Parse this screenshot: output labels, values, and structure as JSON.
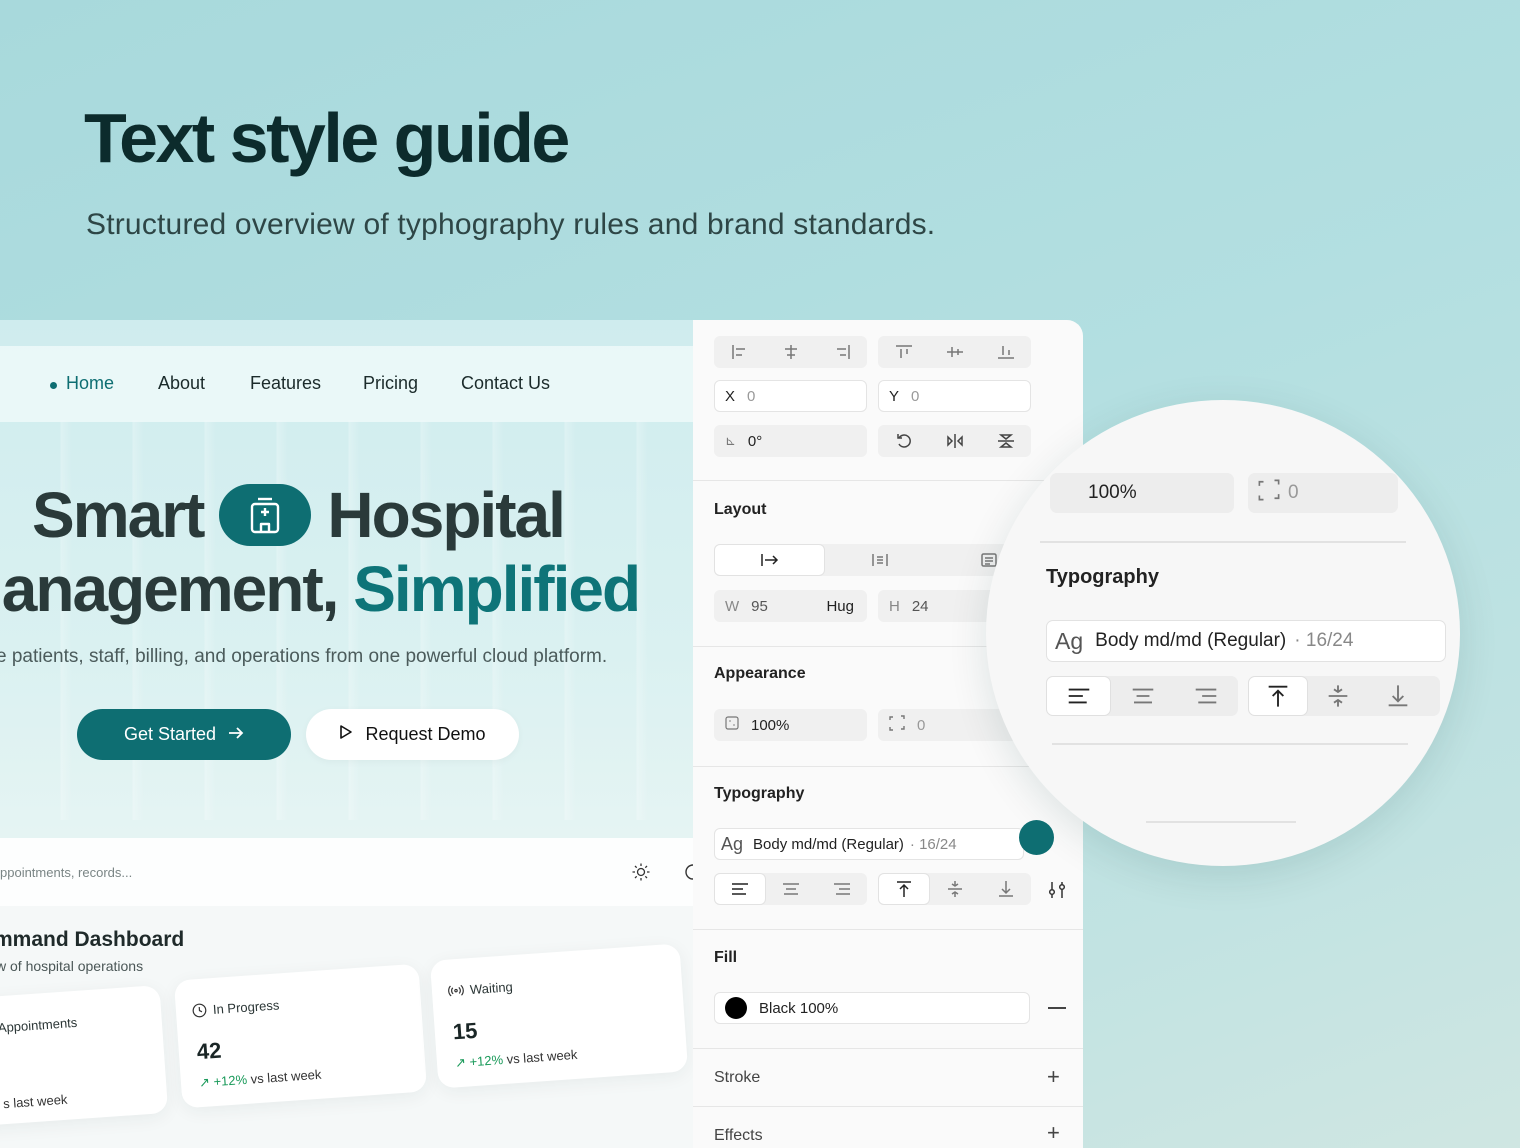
{
  "page": {
    "title": "Text style guide",
    "subtitle": "Structured overview of typhography rules and brand standards."
  },
  "landing": {
    "nav": [
      "Home",
      "About",
      "Features",
      "Pricing",
      "Contact Us"
    ],
    "hero_line1_a": "Smart",
    "hero_line1_b": "Hospital",
    "hero_line2_a": "lanagement,",
    "hero_line2_b": "Simplified",
    "hero_desc": "e patients, staff, billing, and operations from one powerful cloud platform.",
    "primary_cta": "Get Started",
    "secondary_cta": "Request Demo",
    "search_placeholder": "ppointments, records...",
    "dashboard_title": "mmand Dashboard",
    "dashboard_sub": "w of hospital operations",
    "cards": [
      {
        "label": "Appointments",
        "value": "",
        "trend_pct": "",
        "trend_text": "s last week"
      },
      {
        "label": "In Progress",
        "value": "42",
        "trend_pct": "+12%",
        "trend_text": "vs last week"
      },
      {
        "label": "Waiting",
        "value": "15",
        "trend_pct": "+12%",
        "trend_text": "vs last week"
      }
    ],
    "accent_color": "#0e6e72"
  },
  "panel": {
    "x_label": "X",
    "x_value": "0",
    "y_label": "Y",
    "y_value": "0",
    "rotation": "0°",
    "layout_title": "Layout",
    "w_label": "W",
    "w_value": "95",
    "w_mode": "Hug",
    "h_label": "H",
    "h_value": "24",
    "appearance_title": "Appearance",
    "opacity": "100%",
    "radius": "0",
    "typography_title": "Typography",
    "type_prefix": "Ag",
    "type_style": "Body md/md (Regular)",
    "type_size": "· 16/24",
    "fill_title": "Fill",
    "fill_value": "Black 100%",
    "fill_color": "#000000",
    "stroke_title": "Stroke",
    "effects_title": "Effects"
  },
  "magnifier": {
    "opacity": "100%",
    "radius": "0",
    "typography_title": "Typography",
    "type_prefix": "Ag",
    "type_style": "Body md/md (Regular)",
    "type_size": "· 16/24"
  }
}
